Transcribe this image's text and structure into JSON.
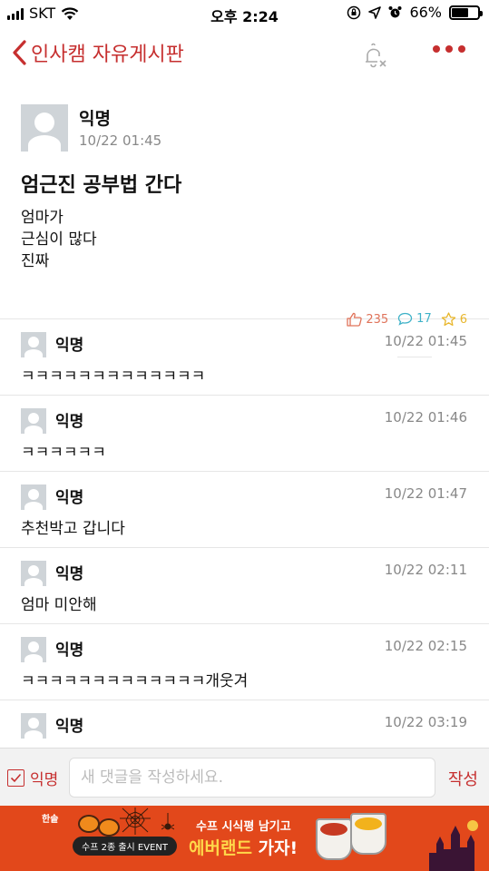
{
  "status_bar": {
    "carrier": "SKT",
    "time": "오후 2:24",
    "battery": "66%",
    "battery_level": 0.66
  },
  "nav": {
    "back_label": "인사캠 자유게시판"
  },
  "post": {
    "author": "익명",
    "date": "10/22 01:45",
    "title": "엄근진 공부법 간다",
    "content_lines": [
      "엄마가",
      "근심이 많다",
      "진짜"
    ],
    "likes": "235",
    "comments": "17",
    "scraps": "6"
  },
  "comments": [
    {
      "author": "익명",
      "time": "10/22 01:45",
      "text": "ㅋㅋㅋㅋㅋㅋㅋㅋㅋㅋㅋㅋㅋ"
    },
    {
      "author": "익명",
      "time": "10/22 01:46",
      "text": "ㅋㅋㅋㅋㅋㅋ"
    },
    {
      "author": "익명",
      "time": "10/22 01:47",
      "text": "추천박고 갑니다"
    },
    {
      "author": "익명",
      "time": "10/22 02:11",
      "text": "엄마 미안해"
    },
    {
      "author": "익명",
      "time": "10/22 02:15",
      "text": "ㅋㅋㅋㅋㅋㅋㅋㅋㅋㅋㅋㅋㅋ개웃겨"
    },
    {
      "author": "익명",
      "time": "10/22 03:19",
      "text": ""
    }
  ],
  "input_bar": {
    "anon_label": "익명",
    "placeholder": "새 댓글을 작성하세요.",
    "submit_label": "작성"
  },
  "ad": {
    "brand": "한솥",
    "pill_text": "수프 2종 출시 EVENT",
    "line1": "수프 시식평 남기고",
    "line2_a": "에버랜드",
    "line2_b": " 가자!"
  },
  "colors": {
    "accent": "#c62f2f",
    "ad_bg": "#e2481b",
    "like": "#e0735a",
    "comment": "#3fb2c8",
    "scrap": "#e8b62c"
  }
}
